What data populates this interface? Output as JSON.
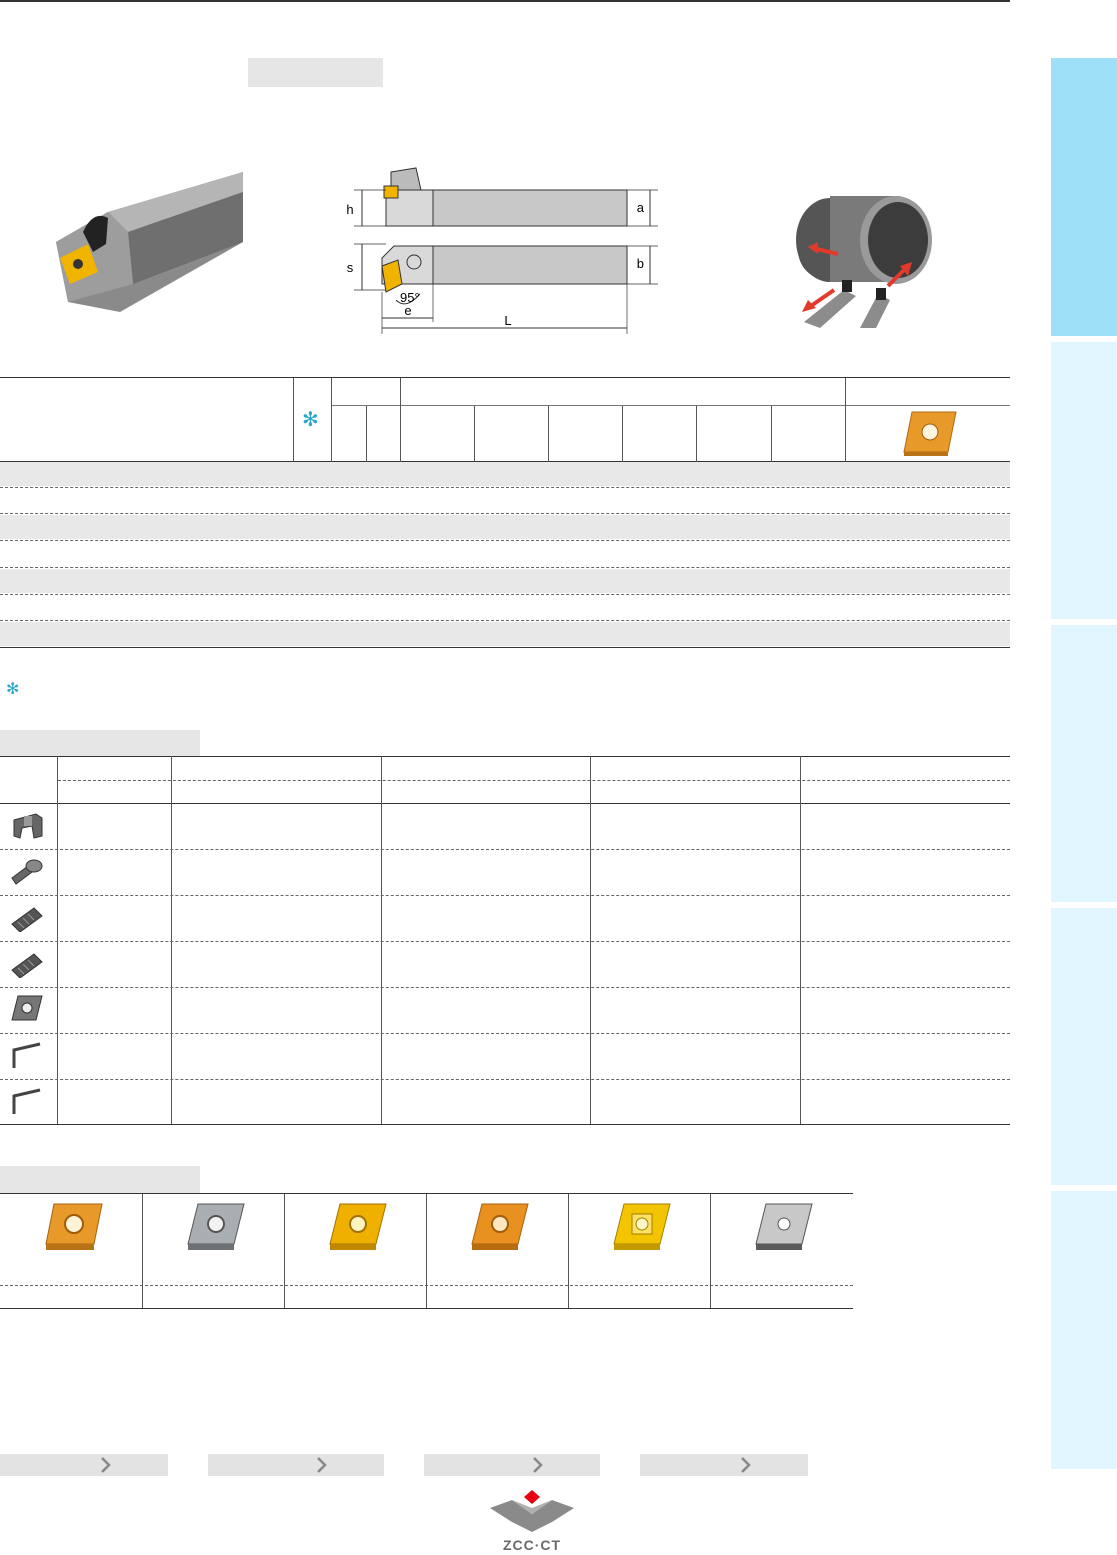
{
  "page": {
    "title_label": "",
    "footnote_star": "✻",
    "legend_star": "✻"
  },
  "diagram": {
    "labels": {
      "h": "h",
      "a": "a",
      "s": "s",
      "b": "b",
      "angle": "95°",
      "e": "e",
      "L": "L"
    }
  },
  "colors": {
    "side_tab_primary": "#9ee0f7",
    "side_tab_secondary": "#e0f5fd",
    "band_gray": "#e8e8e8",
    "star_accent": "#2aa7c9",
    "insert_gold": "#e79a2a",
    "logo_red": "#e60012",
    "logo_gray": "#7b7b7b"
  },
  "sections": {
    "spare_parts_title": "",
    "inserts_title": ""
  },
  "icons": {
    "spare_parts": [
      "clamp-icon",
      "pin-icon",
      "screw-icon",
      "screw-icon",
      "shim-icon",
      "hex-key-icon",
      "hex-key-icon"
    ],
    "inserts": [
      "insert-cnmg-gold-icon",
      "insert-cnmg-silver-icon",
      "insert-cnmg-gold-icon",
      "insert-cnmg-gold-icon",
      "insert-cnmg-yellow-icon",
      "insert-cnma-gray-icon"
    ]
  },
  "logo": {
    "text": "ZCC·CT"
  }
}
